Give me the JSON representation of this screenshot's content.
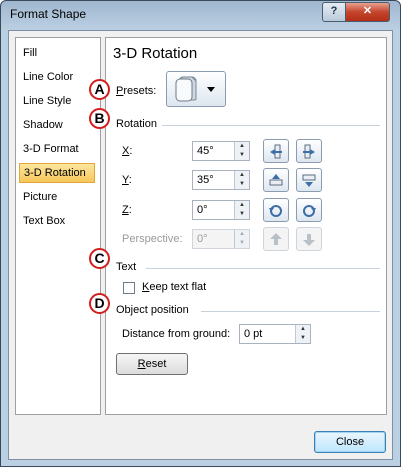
{
  "window": {
    "title": "Format Shape",
    "help_label": "?",
    "close_label": "✕"
  },
  "sidebar": {
    "items": [
      {
        "label": "Fill"
      },
      {
        "label": "Line Color"
      },
      {
        "label": "Line Style"
      },
      {
        "label": "Shadow"
      },
      {
        "label": "3-D Format"
      },
      {
        "label": "3-D Rotation"
      },
      {
        "label": "Picture"
      },
      {
        "label": "Text Box"
      }
    ],
    "selected": "3-D Rotation"
  },
  "panel": {
    "title": "3-D Rotation",
    "presets": {
      "label_underlined": "P",
      "label_rest": "resets:"
    },
    "rotation": {
      "heading": "Rotation",
      "x": {
        "label_underlined": "X",
        "label_rest": ":",
        "value": "45°"
      },
      "y": {
        "label_underlined": "Y",
        "label_rest": ":",
        "value": "35°"
      },
      "z": {
        "label_underlined": "Z",
        "label_rest": ":",
        "value": "0°"
      },
      "perspective": {
        "label": "Perspective:",
        "value": "0°"
      }
    },
    "text": {
      "heading": "Text",
      "keep_flat_underlined": "K",
      "keep_flat_rest": "eep text flat",
      "keep_flat_checked": false
    },
    "object_position": {
      "heading": "Object position",
      "distance_label": "Distance from ground:",
      "distance_value": "0 pt"
    },
    "reset": {
      "underlined": "R",
      "rest": "eset"
    }
  },
  "badges": [
    "A",
    "B",
    "C",
    "D"
  ],
  "footer": {
    "close_label": "Close"
  },
  "colors": {
    "badge_ring": "#d21e1e",
    "selected_item": "#f6c65a",
    "rotate_arrow": "#3c6ea8"
  }
}
